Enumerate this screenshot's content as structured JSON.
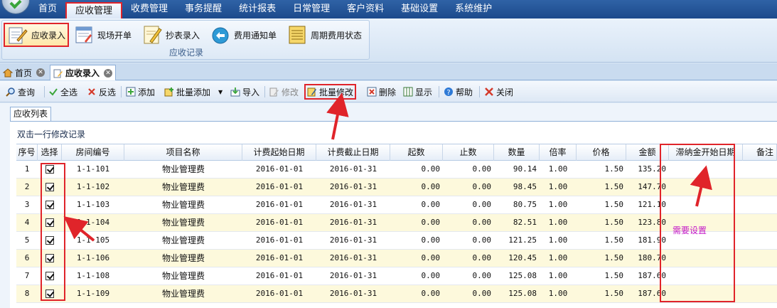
{
  "menu": {
    "items": [
      "首页",
      "应收管理",
      "收费管理",
      "事务提醒",
      "统计报表",
      "日常管理",
      "客户资料",
      "基础设置",
      "系统维护"
    ],
    "active_index": 1
  },
  "ribbon": {
    "group_label": "应收记录",
    "buttons": [
      {
        "label": "应收录入",
        "icon": "edit-document-icon"
      },
      {
        "label": "现场开单",
        "icon": "form-icon"
      },
      {
        "label": "抄表录入",
        "icon": "pencil-note-icon"
      },
      {
        "label": "费用通知单",
        "icon": "notice-icon"
      },
      {
        "label": "周期费用状态",
        "icon": "ledger-icon"
      }
    ]
  },
  "doctabs": [
    {
      "label": "首页"
    },
    {
      "label": "应收录入"
    }
  ],
  "toolbar": {
    "query": "查询",
    "select_all": "全选",
    "invert": "反选",
    "add": "添加",
    "batch_add": "批量添加",
    "import": "导入",
    "edit": "修改",
    "batch_edit": "批量修改",
    "delete": "删除",
    "show": "显示",
    "help": "帮助",
    "close": "关闭"
  },
  "panel": {
    "tab_label": "应收列表",
    "hint": "双击一行修改记录"
  },
  "grid": {
    "columns": [
      "序号",
      "选择",
      "房间编号",
      "项目名称",
      "计费起始日期",
      "计费截止日期",
      "起数",
      "止数",
      "数量",
      "倍率",
      "价格",
      "金额",
      "滞纳金开始日期",
      "备注"
    ],
    "rows": [
      {
        "no": "1",
        "room": "1-1-101",
        "item": "物业管理费",
        "start": "2016-01-01",
        "end": "2016-01-31",
        "from": "0.00",
        "to": "0.00",
        "qty": "90.14",
        "rate": "1.00",
        "price": "1.50",
        "amount": "135.20"
      },
      {
        "no": "2",
        "room": "1-1-102",
        "item": "物业管理费",
        "start": "2016-01-01",
        "end": "2016-01-31",
        "from": "0.00",
        "to": "0.00",
        "qty": "98.45",
        "rate": "1.00",
        "price": "1.50",
        "amount": "147.70"
      },
      {
        "no": "3",
        "room": "1-1-103",
        "item": "物业管理费",
        "start": "2016-01-01",
        "end": "2016-01-31",
        "from": "0.00",
        "to": "0.00",
        "qty": "80.75",
        "rate": "1.00",
        "price": "1.50",
        "amount": "121.10"
      },
      {
        "no": "4",
        "room": "1-1-104",
        "item": "物业管理费",
        "start": "2016-01-01",
        "end": "2016-01-31",
        "from": "0.00",
        "to": "0.00",
        "qty": "82.51",
        "rate": "1.00",
        "price": "1.50",
        "amount": "123.80"
      },
      {
        "no": "5",
        "room": "1-1-105",
        "item": "物业管理费",
        "start": "2016-01-01",
        "end": "2016-01-31",
        "from": "0.00",
        "to": "0.00",
        "qty": "121.25",
        "rate": "1.00",
        "price": "1.50",
        "amount": "181.90"
      },
      {
        "no": "6",
        "room": "1-1-106",
        "item": "物业管理费",
        "start": "2016-01-01",
        "end": "2016-01-31",
        "from": "0.00",
        "to": "0.00",
        "qty": "120.45",
        "rate": "1.00",
        "price": "1.50",
        "amount": "180.70"
      },
      {
        "no": "7",
        "room": "1-1-108",
        "item": "物业管理费",
        "start": "2016-01-01",
        "end": "2016-01-31",
        "from": "0.00",
        "to": "0.00",
        "qty": "125.08",
        "rate": "1.00",
        "price": "1.50",
        "amount": "187.60"
      },
      {
        "no": "8",
        "room": "1-1-109",
        "item": "物业管理费",
        "start": "2016-01-01",
        "end": "2016-01-31",
        "from": "0.00",
        "to": "0.00",
        "qty": "125.08",
        "rate": "1.00",
        "price": "1.50",
        "amount": "187.60"
      }
    ]
  },
  "annotation": {
    "note": "需要设置",
    "color": "#c418c8",
    "highlight_color": "#e0242a"
  }
}
